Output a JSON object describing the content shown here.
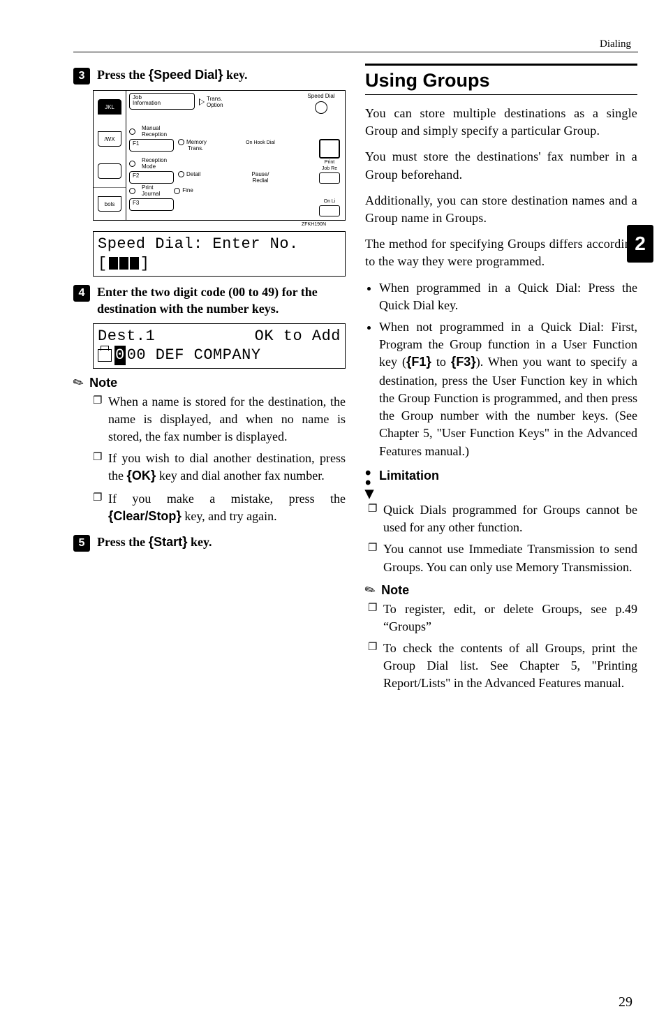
{
  "runningHead": "Dialing",
  "tabNumber": "2",
  "pageNumber": "29",
  "left": {
    "step3": {
      "num": "3",
      "textA": "Press the ",
      "key": "Speed Dial",
      "textB": " key."
    },
    "panel": {
      "jkl": "JKL",
      "wx": "/WX",
      "bols": "bols",
      "jobInfoA": "Job",
      "jobInfoB": "Information",
      "transA": "Trans.",
      "transB": "Option",
      "speedDial": "Speed Dial",
      "manualRec": "Manual\nReception",
      "f1": "F1",
      "memA": "Memory",
      "memB": "Trans.",
      "onHook": "On Hook Dial",
      "print": "Print",
      "recMode": "Reception\nMode",
      "jobRe": "Job Re",
      "f2": "F2",
      "detail": "Detail",
      "pauseA": "Pause/",
      "pauseB": "Redial",
      "printJ": "Print\nJournal",
      "fine": "Fine",
      "onLi": "On Li",
      "f3": "F3",
      "code": "ZFKH190N"
    },
    "lcd1": {
      "l1": "Speed Dial:  Enter No.",
      "l2prefix": "[",
      "l2suffix": "]"
    },
    "step4": {
      "num": "4",
      "text": "Enter the two digit code (00 to 49) for the destination with the number keys."
    },
    "lcd2": {
      "l1a": "Dest.1",
      "l1b": "OK to Add",
      "l2a": "00 DEF COMPANY"
    },
    "noteLabel": "Note",
    "notes": [
      "When a name is stored for the destination, the name is displayed, and when no name is stored, the fax number is displayed.",
      {
        "pre": "If you wish to dial another destination, press the ",
        "key": "OK",
        "post": " key and dial another fax number."
      },
      {
        "pre": "If you make a mistake, press the ",
        "key": "Clear/Stop",
        "post": " key, and try again."
      }
    ],
    "step5": {
      "num": "5",
      "textA": "Press the ",
      "key": "Start",
      "textB": " key."
    }
  },
  "right": {
    "heading": "Using Groups",
    "p1": "You can store multiple destinations as a single Group and simply specify a particular Group.",
    "p2": "You must store the destinations' fax number in a Group beforehand.",
    "p3": "Additionally, you can store destination names and a Group name in Groups.",
    "p4": "The method for specifying Groups differs according to the way they were programmed.",
    "bullets": [
      "When programmed in a Quick Dial: Press the Quick Dial key.",
      {
        "pre": "When not programmed in a Quick Dial: First, Program the Group function in a User Function key (",
        "k1": "F1",
        "mid": " to ",
        "k2": "F3",
        "post": "). When you want to specify a destination, press the User Function key in which the Group Function is programmed, and then press the Group number with the number keys. (See Chapter 5, \"User Function Keys\" in the Advanced Features manual.)"
      }
    ],
    "limitationLabel": "Limitation",
    "limits": [
      "Quick Dials programmed for Groups cannot be used for any other function.",
      "You cannot use Immediate Transmission to send Groups. You can only use Memory Transmission."
    ],
    "noteLabel": "Note",
    "rnotes": [
      "To register, edit, or delete Groups, see p.49 “Groups”",
      "To check the contents of all Groups, print the Group Dial list. See Chapter 5, \"Printing Report/Lists\" in the Advanced Features manual."
    ]
  }
}
